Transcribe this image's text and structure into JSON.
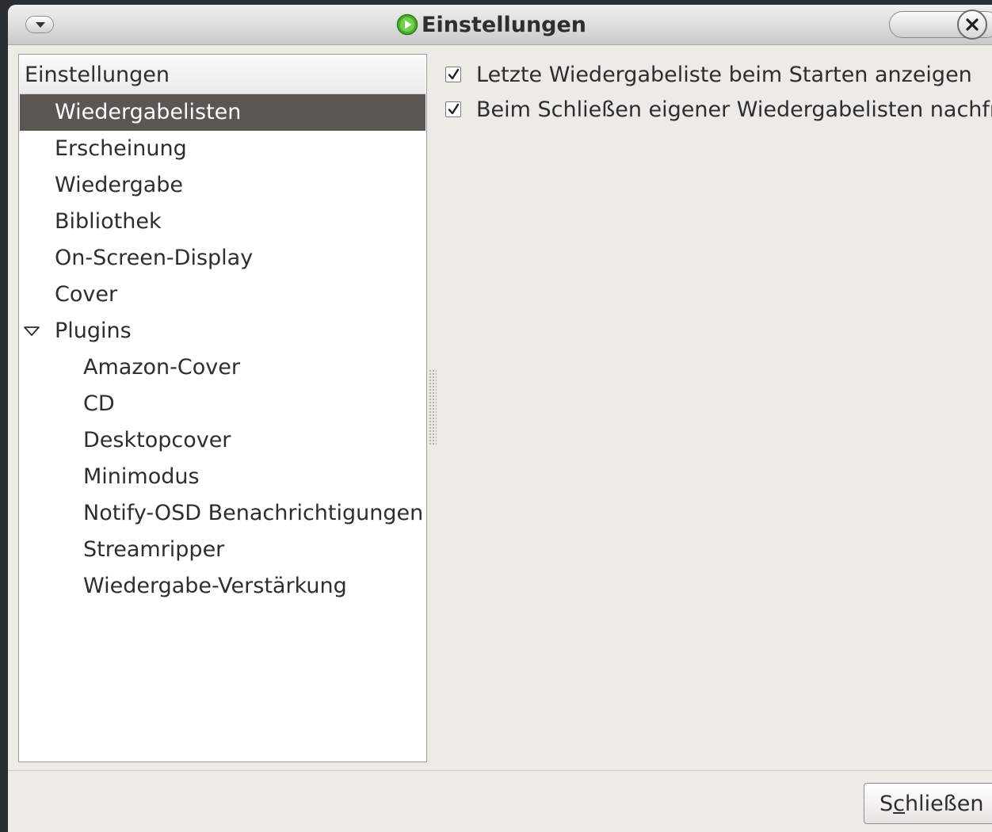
{
  "window": {
    "title": "Einstellungen",
    "menu_icon": "chevron-down-icon",
    "app_icon": "play-icon",
    "close_icon": "close-icon"
  },
  "tree": {
    "header": "Einstellungen",
    "selected": "Wiedergabelisten",
    "items": [
      {
        "label": "Wiedergabelisten"
      },
      {
        "label": "Erscheinung"
      },
      {
        "label": "Wiedergabe"
      },
      {
        "label": "Bibliothek"
      },
      {
        "label": "On-Screen-Display"
      },
      {
        "label": "Cover"
      },
      {
        "label": "Plugins",
        "expanded": true
      }
    ],
    "plugins": [
      {
        "label": "Amazon-Cover"
      },
      {
        "label": "CD"
      },
      {
        "label": "Desktopcover"
      },
      {
        "label": "Minimodus"
      },
      {
        "label": "Notify-OSD Benachrichtigungen"
      },
      {
        "label": "Streamripper"
      },
      {
        "label": "Wiedergabe-Verstärkung"
      }
    ]
  },
  "options": [
    {
      "label": "Letzte Wiedergabeliste beim Starten anzeigen",
      "checked": true
    },
    {
      "label": "Beim Schließen eigener Wiedergabelisten nachfra",
      "checked": true
    }
  ],
  "footer": {
    "close_button": {
      "label_before": "S",
      "label_mnemonic": "c",
      "label_after": "hließen"
    }
  },
  "colors": {
    "window_bg": "#edebe6",
    "selection_bg": "#5a5651",
    "app_icon_green": "#4caf2a"
  }
}
